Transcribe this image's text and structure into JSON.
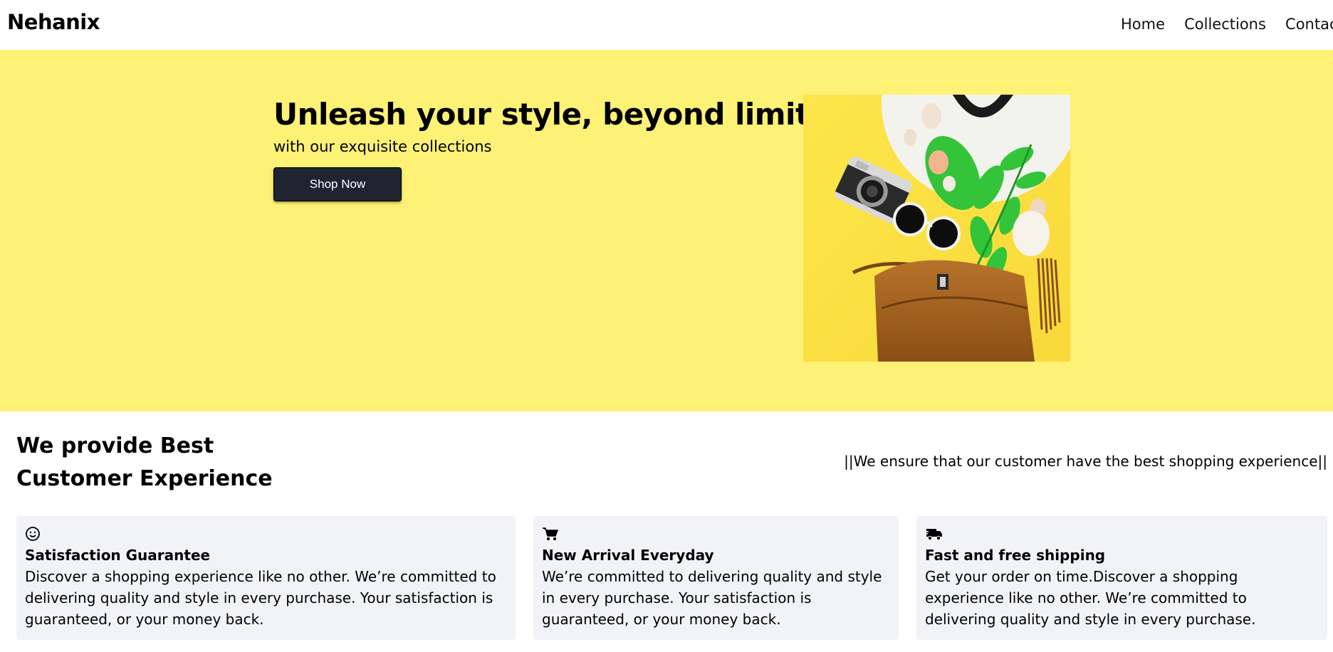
{
  "nav": {
    "brand": "Nehanix",
    "links": [
      "Home",
      "Collections",
      "Contact"
    ]
  },
  "hero": {
    "title": "Unleash your style, beyond limits",
    "subtitle": "with our exquisite collections",
    "cta_label": "Shop Now",
    "background_color": "#fdf176",
    "image_icon": "fashion-flatlay-image"
  },
  "features_section": {
    "title_line1": "We provide Best",
    "title_line2": "Customer Experience",
    "tagline": "||We ensure that our customer have the best shopping experience||",
    "cards": [
      {
        "icon": "smiley-icon",
        "title": "Satisfaction Guarantee",
        "text": "Discover a shopping experience like no other. We’re committed to delivering quality and style in every purchase. Your satisfaction is guaranteed, or your money back."
      },
      {
        "icon": "cart-icon",
        "title": "New Arrival Everyday",
        "text": "We’re committed to delivering quality and style in every purchase. Your satisfaction is guaranteed, or your money back."
      },
      {
        "icon": "truck-icon",
        "title": "Fast and free shipping",
        "text": "Get your order on time.Discover a shopping experience like no other. We’re committed to delivering quality and style in every purchase."
      }
    ]
  },
  "colors": {
    "hero_bg": "#fdf176",
    "button_bg": "#1f2430",
    "card_bg": "#f2f3f6"
  }
}
